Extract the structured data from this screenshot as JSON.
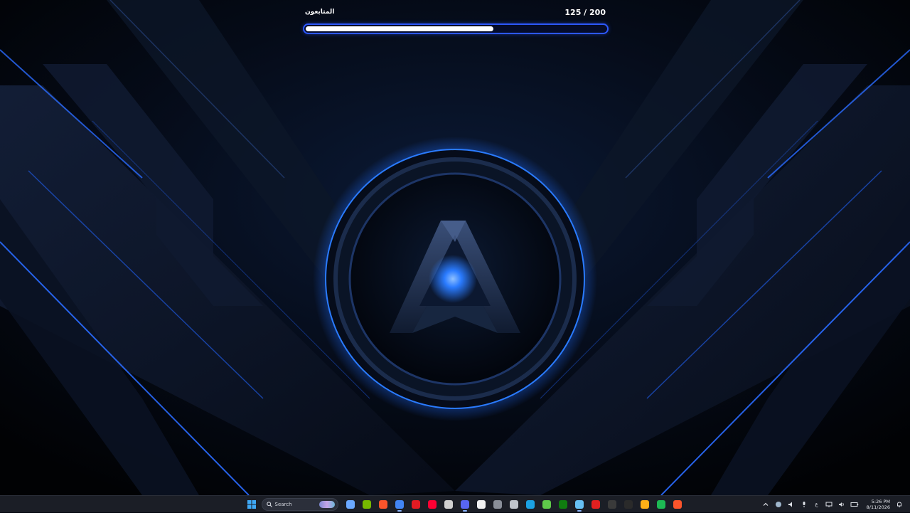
{
  "widget": {
    "label": "المتابعون",
    "current": 125,
    "goal": 200,
    "count_text": "125 / 200",
    "progress": 0.625,
    "track_color": "#2d58ff",
    "fill_color": "#ffffff"
  },
  "wallpaper": {
    "accent": "#1e6bff",
    "glow": "#2a7bff",
    "background": "#03060d"
  },
  "taskbar": {
    "search_placeholder": "Search",
    "apps": [
      {
        "name": "copilot-icon",
        "color": "#6aa8ff",
        "running": false
      },
      {
        "name": "nvidia-icon",
        "color": "#76b900",
        "running": false
      },
      {
        "name": "brave-icon",
        "color": "#fb542b",
        "running": false
      },
      {
        "name": "chrome-icon",
        "color": "#4285f4",
        "running": true
      },
      {
        "name": "red-app-icon",
        "color": "#e31b23",
        "running": false
      },
      {
        "name": "youtube-music-icon",
        "color": "#ff0033",
        "running": false
      },
      {
        "name": "obs-icon",
        "color": "#d0d0d0",
        "running": false
      },
      {
        "name": "discord-icon",
        "color": "#5865f2",
        "running": true
      },
      {
        "name": "notepad-icon",
        "color": "#f2f2f2",
        "running": false
      },
      {
        "name": "tool-icon",
        "color": "#8a8f99",
        "running": false
      },
      {
        "name": "settings-icon",
        "color": "#bfc4cc",
        "running": false
      },
      {
        "name": "edge-icon",
        "color": "#1ba1e2",
        "running": false
      },
      {
        "name": "bluestacks-icon",
        "color": "#5fc94a",
        "running": false
      },
      {
        "name": "xbox-icon",
        "color": "#107c10",
        "running": false
      },
      {
        "name": "steam-icon",
        "color": "#66c0f4",
        "running": true
      },
      {
        "name": "red-circle-icon",
        "color": "#e02020",
        "running": false
      },
      {
        "name": "terminal-icon",
        "color": "#3a3a3a",
        "running": false
      },
      {
        "name": "a-logo-icon",
        "color": "#2a2a2a",
        "running": false
      },
      {
        "name": "rockstar-icon",
        "color": "#fcaf17",
        "running": false
      },
      {
        "name": "spotify-icon",
        "color": "#1db954",
        "running": false
      },
      {
        "name": "brave-icon-2",
        "color": "#fb542b",
        "running": false
      }
    ],
    "tray": {
      "language": "ع",
      "time": "5:26 PM",
      "date": "8/11/2026"
    }
  }
}
